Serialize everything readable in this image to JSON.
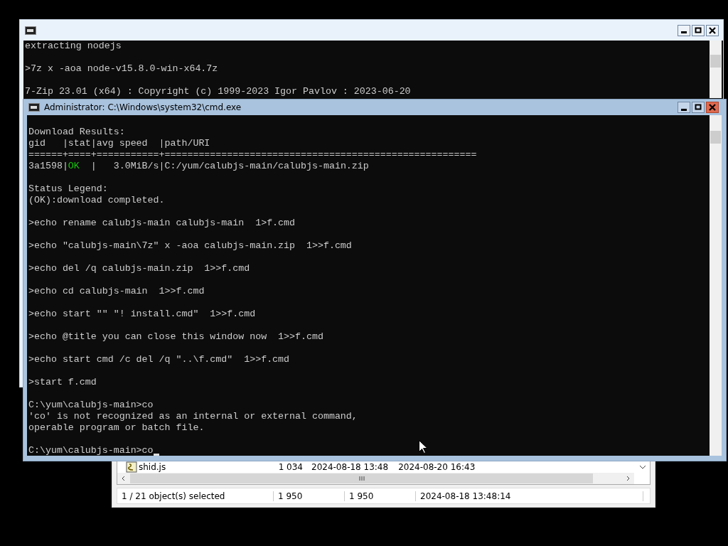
{
  "back_console": {
    "blocks": [
      [
        "extracting nodejs"
      ],
      [
        ">7z x -aoa node-v15.8.0-win-x64.7z"
      ],
      [
        "7-Zip 23.01 (x64) : Copyright (c) 1999-2023 Igor Pavlov : 2023-06-20"
      ]
    ]
  },
  "front_console": {
    "title": "Administrator: C:\\Windows\\system32\\cmd.exe",
    "blocks": [
      [
        [
          {
            "text": "Download Results:"
          }
        ],
        [
          {
            "text": "gid   |stat|avg speed  |path/URI"
          }
        ],
        [
          {
            "text": "======+====+===========+======================================================="
          }
        ],
        [
          {
            "text": "3a1598|"
          },
          {
            "text": "OK",
            "kind": "success"
          },
          {
            "text": "  |   3.0MiB/s|C:/yum/calubjs-main/calubjs-main.zip"
          }
        ]
      ],
      [
        [
          {
            "text": "Status Legend:"
          }
        ],
        [
          {
            "text": "(OK):download completed."
          }
        ]
      ],
      [
        [
          {
            "text": ">echo rename calubjs-main calubjs-main  1>f.cmd"
          }
        ]
      ],
      [
        [
          {
            "text": ">echo \"calubjs-main\\7z\" x -aoa calubjs-main.zip  1>>f.cmd"
          }
        ]
      ],
      [
        [
          {
            "text": ">echo del /q calubjs-main.zip  1>>f.cmd"
          }
        ]
      ],
      [
        [
          {
            "text": ">echo cd calubjs-main  1>>f.cmd"
          }
        ]
      ],
      [
        [
          {
            "text": ">echo start \"\" \"! install.cmd\"  1>>f.cmd"
          }
        ]
      ],
      [
        [
          {
            "text": ">echo @title you can close this window now  1>>f.cmd"
          }
        ]
      ],
      [
        [
          {
            "text": ">echo start cmd /c del /q \"..\\f.cmd\"  1>>f.cmd"
          }
        ]
      ],
      [
        [
          {
            "text": ">start f.cmd"
          }
        ]
      ],
      [
        [
          {
            "text": "C:\\yum\\calubjs-main>co"
          }
        ],
        [
          {
            "text": "'co' is not recognized as an internal or external command,"
          }
        ],
        [
          {
            "text": "operable program or batch file."
          }
        ]
      ]
    ],
    "prompt": "C:\\yum\\calubjs-main>co"
  },
  "file_manager": {
    "row": {
      "name": "shid.js",
      "size": "1 034",
      "created": "2024-08-18 13:48",
      "modified": "2024-08-20 16:43"
    },
    "status_bar": [
      "1 / 21 object(s) selected",
      "1 950",
      "1 950",
      "2024-08-18 13:48:14"
    ]
  }
}
